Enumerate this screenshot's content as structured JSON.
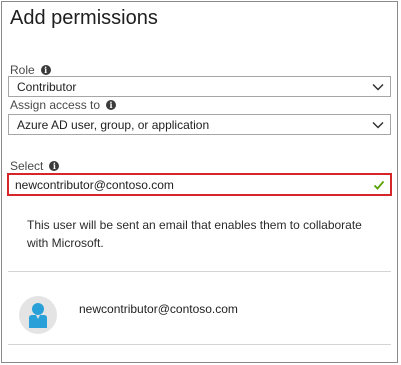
{
  "panel": {
    "title": "Add permissions"
  },
  "role": {
    "label": "Role",
    "value": "Contributor",
    "info_icon": "info-icon"
  },
  "assign": {
    "label": "Assign access to",
    "value": "Azure AD user, group, or application",
    "info_icon": "info-icon"
  },
  "select": {
    "label": "Select",
    "value": "newcontributor@contoso.com",
    "valid_icon": "checkmark-icon",
    "error_border_color": "#d6262a",
    "valid_color": "#57a300",
    "info_icon": "info-icon"
  },
  "notice": {
    "text": "This user will be sent an email that enables them to collaborate with Microsoft."
  },
  "selected_user": {
    "email": "newcontributor@contoso.com",
    "avatar_icon": "user-avatar-icon",
    "avatar_color": "#2aa0d8"
  },
  "icons": {
    "dropdown": "chevron-down-icon"
  }
}
